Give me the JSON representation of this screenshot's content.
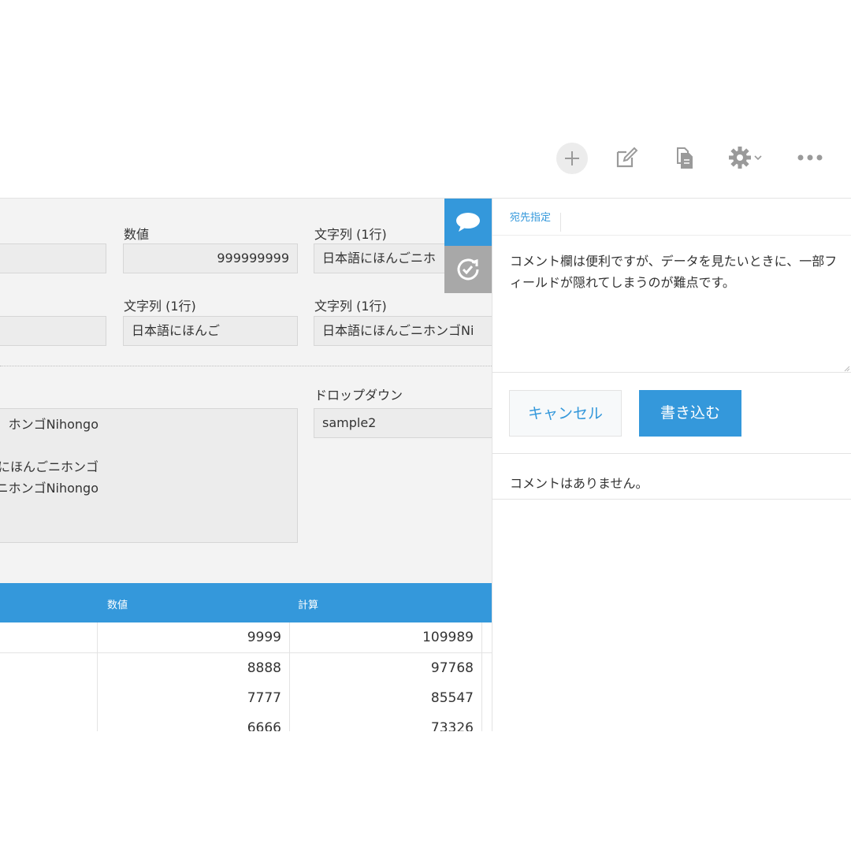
{
  "toolbar": {
    "icons": [
      "plus-icon",
      "edit-icon",
      "duplicate-icon",
      "gear-icon",
      "more-icon"
    ]
  },
  "record": {
    "row1": {
      "number_label": "数値",
      "number_value": "999999999",
      "text_label": "文字列 (1行)",
      "text_value": "日本語にほんごニホ"
    },
    "row2": {
      "text_label_a": "文字列 (1行)",
      "text_value_a": "日本語にほんご",
      "text_label_b": "文字列 (1行)",
      "text_value_b": "日本語にほんごニホンゴNi"
    },
    "multiline": {
      "lines": [
        "ホンゴNihongo",
        "",
        "ホンゴNihongo日本語にほんごニホンゴ",
        "ほんごニホンゴNihongo"
      ]
    },
    "dropdown": {
      "label": "ドロップダウン",
      "value": "sample2"
    },
    "table": {
      "headers": [
        "数値",
        "計算"
      ],
      "rows": [
        {
          "number": "9999",
          "calc": "109989"
        },
        {
          "number": "8888",
          "calc": "97768"
        },
        {
          "number": "7777",
          "calc": "85547"
        },
        {
          "number": "6666",
          "calc": "73326"
        }
      ]
    }
  },
  "side_tabs": {
    "comments_icon": "speech-bubble-icon",
    "history_icon": "history-icon"
  },
  "comments": {
    "mention_label": "宛先指定",
    "draft_text": "コメント欄は便利ですが、データを見たいときに、一部フィールドが隠れてしまうのが難点です。",
    "cancel_label": "キャンセル",
    "post_label": "書き込む",
    "empty_message": "コメントはありません。"
  },
  "colors": {
    "accent": "#3498db",
    "panel_bg": "#f3f3f3",
    "field_bg": "#ececec"
  }
}
